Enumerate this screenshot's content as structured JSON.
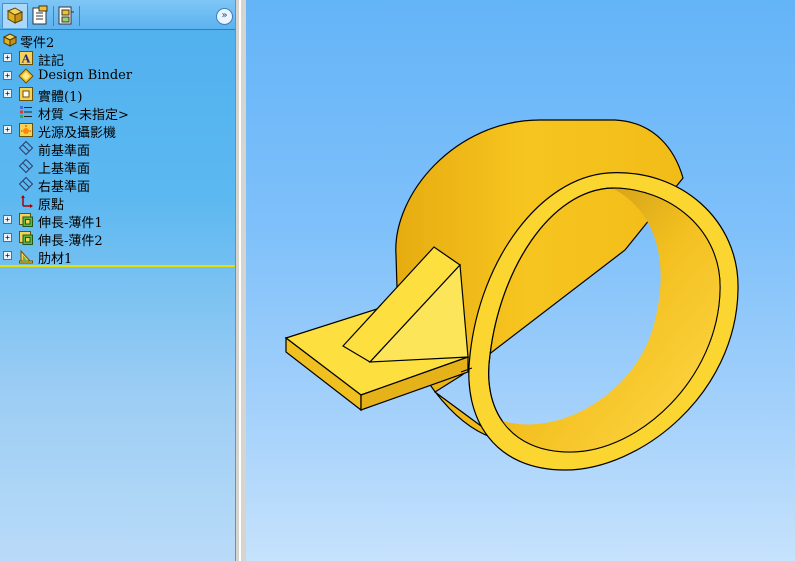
{
  "feature_manager": {
    "tabs": [
      {
        "icon": "feature-manager-tab-icon",
        "active": true
      },
      {
        "icon": "property-manager-tab-icon",
        "active": false
      },
      {
        "icon": "configuration-manager-tab-icon",
        "active": false
      }
    ],
    "expand_label": "»",
    "tree": {
      "root": "零件2",
      "items": [
        {
          "label": "註記",
          "icon": "annotations-icon",
          "expandable": true
        },
        {
          "label": "Design Binder",
          "icon": "design-binder-icon",
          "expandable": true
        },
        {
          "label": "實體(1)",
          "icon": "solid-bodies-icon",
          "expandable": true
        },
        {
          "label": "材質 <未指定>",
          "icon": "material-icon",
          "expandable": false
        },
        {
          "label": "光源及攝影機",
          "icon": "lights-cameras-icon",
          "expandable": true
        },
        {
          "label": "前基準面",
          "icon": "plane-icon",
          "expandable": false
        },
        {
          "label": "上基準面",
          "icon": "plane-icon",
          "expandable": false
        },
        {
          "label": "右基準面",
          "icon": "plane-icon",
          "expandable": false
        },
        {
          "label": "原點",
          "icon": "origin-icon",
          "expandable": false
        },
        {
          "label": "伸長-薄件1",
          "icon": "extrude-thin-icon",
          "expandable": true
        },
        {
          "label": "伸長-薄件2",
          "icon": "extrude-thin-icon",
          "expandable": true
        },
        {
          "label": "肋材1",
          "icon": "rib-icon",
          "expandable": true
        }
      ]
    }
  },
  "colors": {
    "part": "#f4c422",
    "part_light": "#fde26a",
    "part_dark": "#c99a10",
    "rollback_bar": "#e5e000"
  }
}
